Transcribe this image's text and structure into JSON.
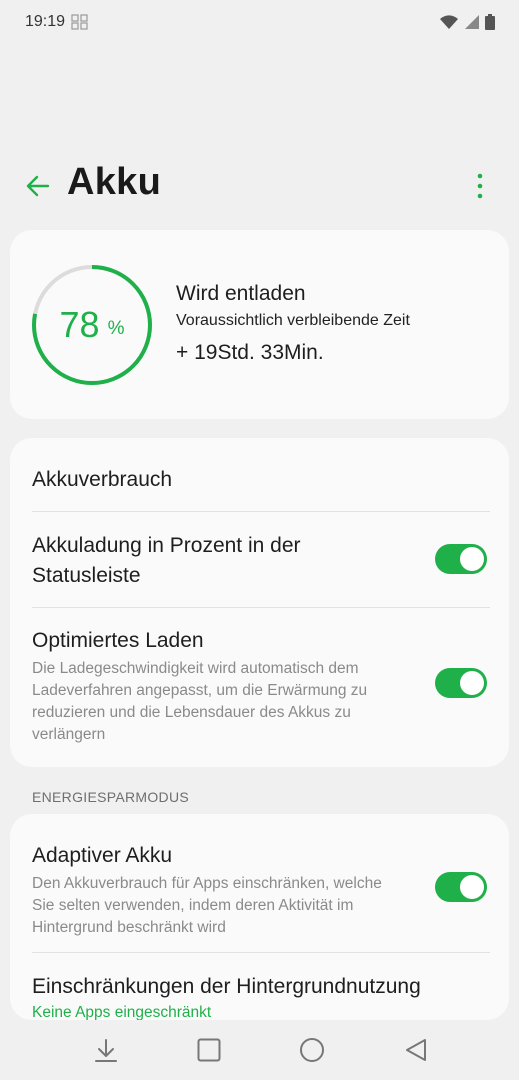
{
  "status_bar": {
    "time": "19:19"
  },
  "header": {
    "title": "Akku"
  },
  "battery": {
    "percent_value": "78",
    "percent_sign": "%",
    "level": 0.78,
    "status": "Wird entladen",
    "estimate_label": "Voraussichtlich verbleibende Zeit",
    "estimate_value": "+ 19Std. 33Min."
  },
  "settings": {
    "usage": {
      "title": "Akkuverbrauch"
    },
    "statusbar_percent": {
      "title_line1": "Akkuladung in Prozent in der",
      "title_line2": "Statusleiste",
      "enabled": true
    },
    "optimized_charging": {
      "title": "Optimiertes Laden",
      "sub_line1": "Die Ladegeschwindigkeit wird automatisch dem",
      "sub_line2": "Ladeverfahren angepasst, um die Erwärmung zu",
      "sub_line3": "reduzieren und die Lebensdauer des Akkus zu",
      "sub_line4": "verlängern",
      "enabled": true
    }
  },
  "energy_section": {
    "label": "ENERGIESPARMODUS",
    "adaptive": {
      "title": "Adaptiver Akku",
      "sub_line1": "Den Akkuverbrauch für Apps einschränken, welche",
      "sub_line2": "Sie selten verwenden, indem deren Aktivität im",
      "sub_line3": "Hintergrund beschränkt wird",
      "enabled": true
    },
    "background": {
      "title": "Einschränkungen der Hintergrundnutzung",
      "sub": "Keine Apps eingeschränkt"
    }
  },
  "colors": {
    "accent": "#20b04a",
    "background": "#f0f0f0",
    "card": "#fafafa"
  },
  "icons": {
    "back": "arrow-left-icon",
    "more": "more-vert-icon",
    "wifi": "wifi-icon",
    "signal": "signal-icon",
    "battery": "battery-icon",
    "nav_down": "nav-down-icon",
    "nav_recents": "nav-square-icon",
    "nav_home": "nav-circle-icon",
    "nav_back": "nav-triangle-icon"
  }
}
